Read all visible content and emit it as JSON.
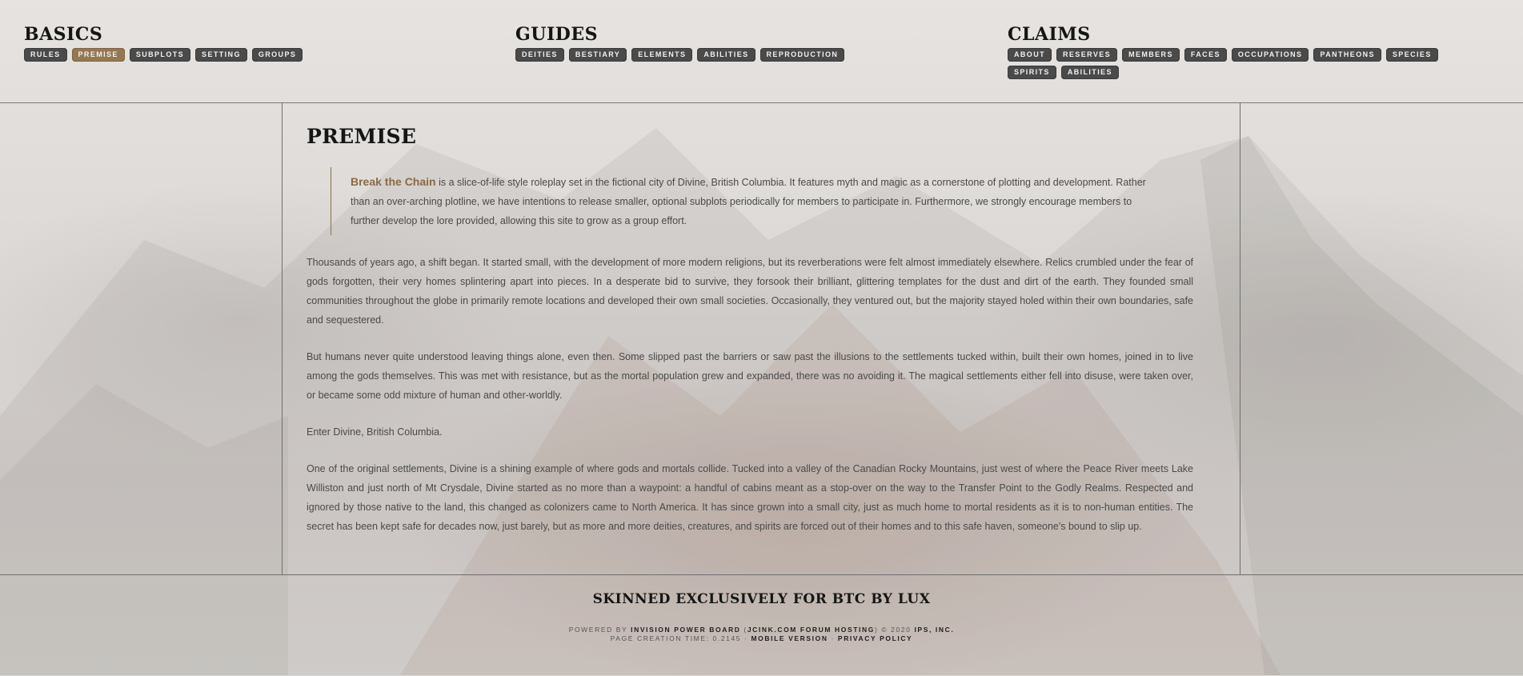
{
  "nav": {
    "basics": {
      "title": "BASICS",
      "items": [
        "RULES",
        "PREMISE",
        "SUBPLOTS",
        "SETTING",
        "GROUPS"
      ]
    },
    "guides": {
      "title": "GUIDES",
      "items": [
        "DEITIES",
        "BESTIARY",
        "ELEMENTS",
        "ABILITIES",
        "REPRODUCTION"
      ]
    },
    "claims": {
      "title": "CLAIMS",
      "items": [
        "ABOUT",
        "RESERVES",
        "MEMBERS",
        "FACES",
        "OCCUPATIONS",
        "PANTHEONS",
        "SPECIES",
        "SPIRITS",
        "ABILITIES"
      ]
    },
    "active_item": "PREMISE",
    "active_color": "#957751",
    "pill_color": "#4a4a4a"
  },
  "main": {
    "title": "PREMISE",
    "quote": {
      "brand": "Break the Chain",
      "text": " is a slice-of-life style roleplay set in the fictional city of Divine, British Columbia. It features myth and magic as a cornerstone of plotting and development. Rather than an over-arching plotline, we have intentions to release smaller, optional subplots periodically for members to participate in. Furthermore, we strongly encourage members to further develop the lore provided, allowing this site to grow as a group effort."
    },
    "paragraphs": [
      "Thousands of years ago, a shift began. It started small, with the development of more modern religions, but its reverberations were felt almost immediately elsewhere. Relics crumbled under the fear of gods forgotten, their very homes splintering apart into pieces. In a desperate bid to survive, they forsook their brilliant, glittering templates for the dust and dirt of the earth. They founded small communities throughout the globe in primarily remote locations and developed their own small societies. Occasionally, they ventured out, but the majority stayed holed within their own boundaries, safe and sequestered.",
      "But humans never quite understood leaving things alone, even then. Some slipped past the barriers or saw past the illusions to the settlements tucked within, built their own homes, joined in to live among the gods themselves. This was met with resistance, but as the mortal population grew and expanded, there was no avoiding it. The magical settlements either fell into disuse, were taken over, or became some odd mixture of human and other-worldly.",
      "Enter Divine, British Columbia.",
      "One of the original settlements, Divine is a shining example of where gods and mortals collide. Tucked into a valley of the Canadian Rocky Mountains, just west of where the Peace River meets Lake Williston and just north of Mt Crysdale, Divine started as no more than a waypoint: a handful of cabins meant as a stop-over on the way to the Transfer Point to the Godly Realms. Respected and ignored by those native to the land, this changed as colonizers came to North America. It has since grown into a small city, just as much home to mortal residents as it is to non-human entities. The secret has been kept safe for decades now, just barely, but as more and more deities, creatures, and spirits are forced out of their homes and to this safe haven, someone's bound to slip up."
    ],
    "brand_color": "#8a6a45"
  },
  "footer": {
    "title": "SKINNED EXCLUSIVELY FOR BTC BY LUX",
    "powered_prefix": "POWERED BY ",
    "powered_board": "INVISION POWER BOARD",
    "powered_host_open": " (",
    "powered_host": "JCINK.COM FORUM HOSTING",
    "powered_copy": ") © 2020 ",
    "powered_company": "IPS, INC.",
    "creation_time": "PAGE CREATION TIME: 0.2145 · ",
    "mobile_link": "MOBILE VERSION",
    "sep": " · ",
    "privacy_link": "PRIVACY POLICY"
  }
}
